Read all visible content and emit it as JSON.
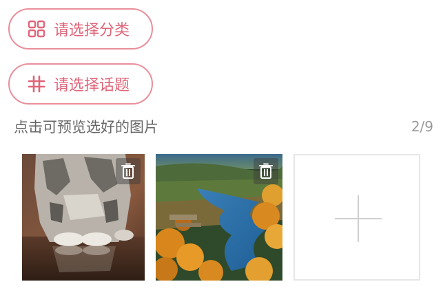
{
  "selectors": {
    "category_label": "请选择分类",
    "topic_label": "请选择话题"
  },
  "images": {
    "hint": "点击可预览选好的图片",
    "count": "2/9",
    "items": [
      {
        "subject": "cat"
      },
      {
        "subject": "river landscape"
      }
    ]
  },
  "icons": {
    "category": "grid-icon",
    "topic": "hash-icon",
    "delete": "trash-icon",
    "add": "plus-icon"
  },
  "colors": {
    "accent": "#e06478",
    "border": "#e98e9a",
    "hint_text": "#666666",
    "count_text": "#999999"
  }
}
